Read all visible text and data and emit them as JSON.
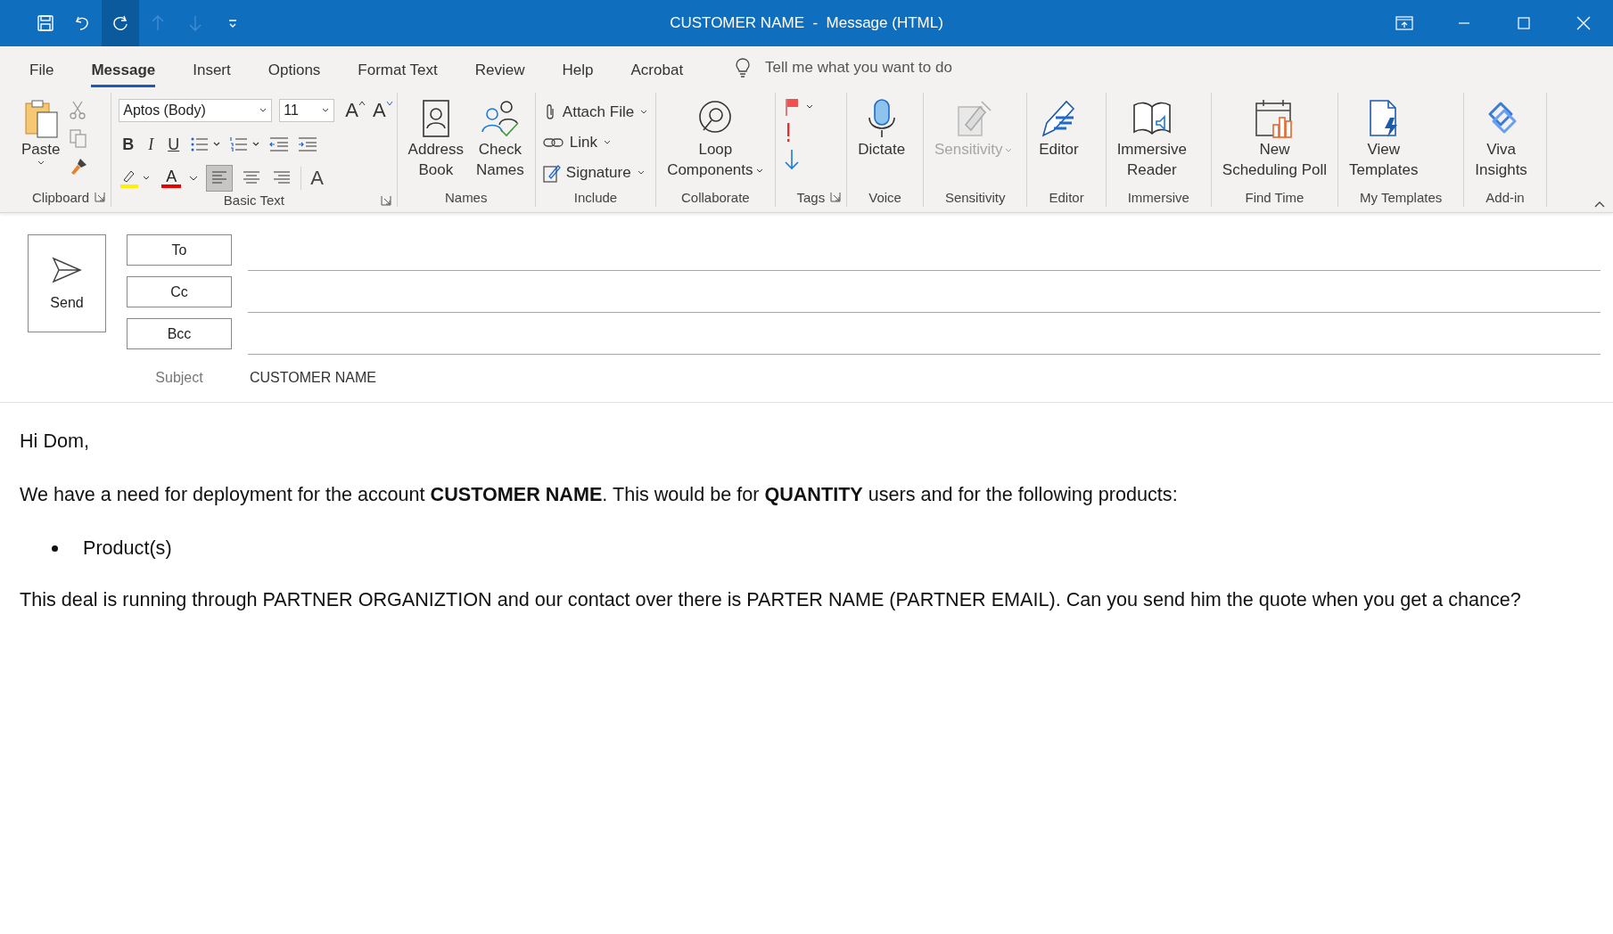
{
  "window": {
    "title": "CUSTOMER NAME  -  Message (HTML)"
  },
  "quick_access": [
    {
      "disabled": false,
      "highlighted": false
    },
    {
      "disabled": false,
      "highlighted": false
    },
    {
      "disabled": false,
      "highlighted": true
    },
    {
      "disabled": true,
      "highlighted": false
    },
    {
      "disabled": true,
      "highlighted": false
    },
    {
      "disabled": false,
      "highlighted": false
    }
  ],
  "tabs": [
    {
      "label": "File",
      "selected": false
    },
    {
      "label": "Message",
      "selected": true
    },
    {
      "label": "Insert",
      "selected": false
    },
    {
      "label": "Options",
      "selected": false
    },
    {
      "label": "Format Text",
      "selected": false
    },
    {
      "label": "Review",
      "selected": false
    },
    {
      "label": "Help",
      "selected": false
    },
    {
      "label": "Acrobat",
      "selected": false
    }
  ],
  "search": {
    "placeholder": "Tell me what you want to do"
  },
  "ribbon": {
    "groups": [
      {
        "kind": "clipboard",
        "label": "Clipboard",
        "launcher": true,
        "paste": "Paste"
      },
      {
        "kind": "basic_text",
        "label": "Basic Text",
        "launcher": true,
        "font": "Aptos (Body)",
        "size": "11",
        "bold": "B",
        "italic": "I",
        "underline": "U",
        "grow": "A",
        "shrink": "A",
        "font_color": "A",
        "clear": "A"
      },
      {
        "kind": "large",
        "label": "Names",
        "launcher": false,
        "buttons": [
          {
            "label": "Address\nBook",
            "disabled": false,
            "dropdown": false
          },
          {
            "label": "Check\nNames",
            "disabled": false,
            "dropdown": false
          }
        ]
      },
      {
        "kind": "include",
        "label": "Include",
        "launcher": false,
        "items": [
          "Attach File",
          "Link",
          "Signature"
        ]
      },
      {
        "kind": "large",
        "label": "Collaborate",
        "launcher": false,
        "buttons": [
          {
            "label": "Loop\nComponents",
            "disabled": false,
            "dropdown": true
          }
        ]
      },
      {
        "kind": "tags",
        "label": "Tags",
        "launcher": true
      },
      {
        "kind": "large",
        "label": "Voice",
        "launcher": false,
        "buttons": [
          {
            "label": "Dictate",
            "disabled": false,
            "dropdown": false
          }
        ]
      },
      {
        "kind": "large",
        "label": "Sensitivity",
        "launcher": false,
        "buttons": [
          {
            "label": "Sensitivity",
            "disabled": true,
            "dropdown": true
          }
        ]
      },
      {
        "kind": "large",
        "label": "Editor",
        "launcher": false,
        "buttons": [
          {
            "label": "Editor",
            "disabled": false,
            "dropdown": false
          }
        ]
      },
      {
        "kind": "large",
        "label": "Immersive",
        "launcher": false,
        "buttons": [
          {
            "label": "Immersive\nReader",
            "disabled": false,
            "dropdown": false
          }
        ]
      },
      {
        "kind": "large",
        "label": "Find Time",
        "launcher": false,
        "buttons": [
          {
            "label": "New\nScheduling Poll",
            "disabled": false,
            "dropdown": false
          }
        ]
      },
      {
        "kind": "large",
        "label": "My Templates",
        "launcher": false,
        "buttons": [
          {
            "label": "View\nTemplates",
            "disabled": false,
            "dropdown": false
          }
        ]
      },
      {
        "kind": "large",
        "label": "Add-in",
        "launcher": false,
        "buttons": [
          {
            "label": "Viva\nInsights",
            "disabled": false,
            "dropdown": false
          }
        ]
      }
    ]
  },
  "compose": {
    "send": "Send",
    "recipients": [
      {
        "label": "To"
      },
      {
        "label": "Cc"
      },
      {
        "label": "Bcc"
      }
    ],
    "subject_label": "Subject",
    "subject": "CUSTOMER NAME"
  },
  "body": [
    {
      "kind": "paragraph",
      "text": "Hi Dom,"
    },
    {
      "kind": "paragraph",
      "text": "We have a need for deployment for the account **CUSTOMER NAME**. This would be for **QUANTITY** users and for the following products:"
    },
    {
      "kind": "bullet",
      "text": "Product(s)"
    },
    {
      "kind": "paragraph",
      "text": "This deal is running through PARTNER ORGANIZTION and our contact over there is PARTER NAME (PARTNER EMAIL). Can you send him the quote when you get a chance?"
    }
  ]
}
